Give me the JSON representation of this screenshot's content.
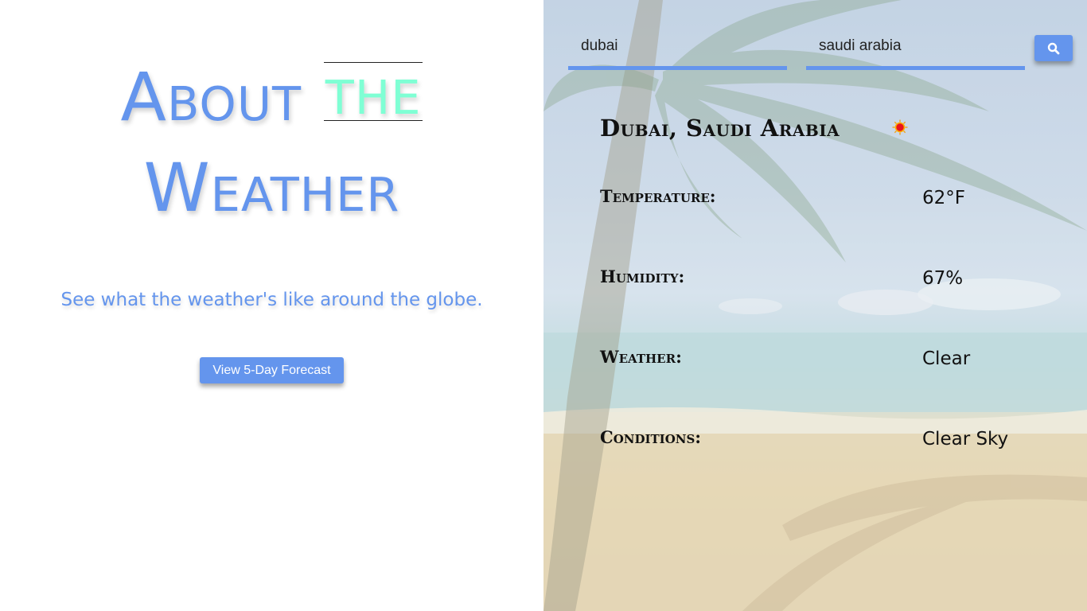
{
  "left_panel": {
    "title_about": "About",
    "title_the": "the",
    "title_weather": "Weather",
    "subtitle": "See what the weather's like around the globe.",
    "forecast_button_label": "View 5-Day Forecast"
  },
  "search": {
    "city_value": "dubai",
    "country_value": "saudi arabia",
    "search_icon": "search-icon"
  },
  "result": {
    "location": "Dubai, Saudi Arabia",
    "weather_icon": "sun-icon",
    "rows": [
      {
        "label": "Temperature:",
        "value": "62°F"
      },
      {
        "label": "Humidity:",
        "value": "67%"
      },
      {
        "label": "Weather:",
        "value": "Clear"
      },
      {
        "label": "Conditions:",
        "value": "Clear Sky"
      }
    ]
  },
  "colors": {
    "accent": "#6495ed",
    "highlight": "#7fffd4",
    "text_dark": "#111111"
  }
}
